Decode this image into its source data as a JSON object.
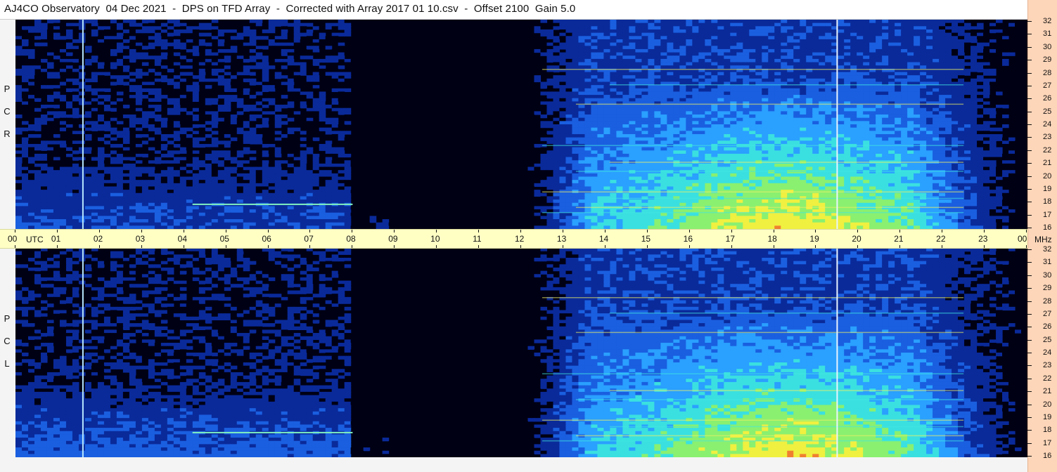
{
  "title": "AJ4CO Observatory  04 Dec 2021  -  DPS on TFD Array  -  Corrected with Array 2017 01 10.csv  -  Offset 2100  Gain 5.0",
  "panels": [
    {
      "id": "rcp",
      "label_letters": [
        "R",
        "C",
        "P"
      ]
    },
    {
      "id": "lcp",
      "label_letters": [
        "L",
        "C",
        "P"
      ]
    }
  ],
  "time_axis": {
    "labels": [
      "00",
      "01",
      "02",
      "03",
      "04",
      "05",
      "06",
      "07",
      "08",
      "09",
      "10",
      "11",
      "12",
      "13",
      "14",
      "15",
      "16",
      "17",
      "18",
      "19",
      "20",
      "21",
      "22",
      "23",
      "00"
    ],
    "unit_left": "UTC",
    "unit_right": "MHz"
  },
  "freq_axis": {
    "labels": [
      "32",
      "31",
      "30",
      "29",
      "28",
      "27",
      "26",
      "25",
      "24",
      "23",
      "22",
      "21",
      "20",
      "19",
      "18",
      "17",
      "16"
    ]
  },
  "colors": {
    "background_dark": "#000014",
    "time_bar": "#ffffc4",
    "freq_strip": "#fdd5b8"
  },
  "chart_data": {
    "type": "heatmap",
    "title": "AJ4CO Observatory  04 Dec 2021  -  DPS on TFD Array  -  Corrected with Array 2017 01 10.csv  -  Offset 2100  Gain 5.0",
    "xlabel": "UTC",
    "ylabel": "MHz",
    "x_range": [
      0,
      24
    ],
    "y_range": [
      16,
      32
    ],
    "x_ticks": [
      "00",
      "01",
      "02",
      "03",
      "04",
      "05",
      "06",
      "07",
      "08",
      "09",
      "10",
      "11",
      "12",
      "13",
      "14",
      "15",
      "16",
      "17",
      "18",
      "19",
      "20",
      "21",
      "22",
      "23",
      "00"
    ],
    "y_ticks": [
      32,
      31,
      30,
      29,
      28,
      27,
      26,
      25,
      24,
      23,
      22,
      21,
      20,
      19,
      18,
      17,
      16
    ],
    "panels": [
      "RCP",
      "LCP"
    ],
    "vertical_markers_utc": [
      1.6,
      19.5
    ],
    "colormap": [
      "#000014",
      "#0a2a9a",
      "#1a5fe0",
      "#2aa0ff",
      "#3ae0e0",
      "#8af070",
      "#f0f040",
      "#f08030",
      "#e02020"
    ]
  }
}
